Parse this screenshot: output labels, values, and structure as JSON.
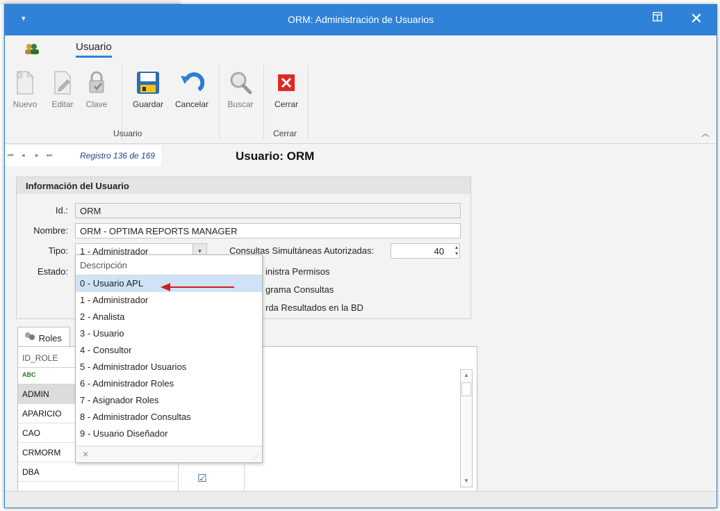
{
  "window": {
    "title": "ORM: Administración de Usuarios"
  },
  "ribbon": {
    "tab": "Usuario",
    "buttons": {
      "nuevo": "Nuevo",
      "editar": "Editar",
      "clave": "Clave",
      "guardar": "Guardar",
      "cancelar": "Cancelar",
      "buscar": "Buscar",
      "cerrar": "Cerrar"
    },
    "groups": {
      "usuario": "Usuario",
      "cerrar": "Cerrar"
    }
  },
  "nav": {
    "registro": "Registro 136 de 169"
  },
  "main_title": "Usuario: ORM",
  "info": {
    "header": "Información del Usuario",
    "id_label": "Id.:",
    "id_value": "ORM",
    "nombre_label": "Nombre:",
    "nombre_value": "ORM - OPTIMA REPORTS MANAGER",
    "tipo_label": "Tipo:",
    "tipo_value": "1 - Administrador",
    "consultas_label": "Consultas Simultáneas Autorizadas:",
    "consultas_value": "40",
    "estado_label": "Estado:",
    "administra_permisos": "inistra Permisos",
    "programa_consultas": "grama Consultas",
    "guarda_resultados": "rda Resultados en la BD"
  },
  "dropdown": {
    "header": "Descripción",
    "options": [
      "0 - Usuario APL",
      "1 - Administrador",
      "2 - Analista",
      "3 - Usuario",
      "4 - Consultor",
      "5 - Administrador Usuarios",
      "6 - Administrador Roles",
      "7 - Asignador Roles",
      "8 - Administrador Consultas",
      "9 - Usuario Diseñador"
    ],
    "highlighted_index": 0,
    "clear_glyph": "×"
  },
  "roles": {
    "tab": "Roles",
    "column_header": "ID_ROLE",
    "filter_glyph": "ABC",
    "rows": [
      "ADMIN",
      "APARICIO",
      "CAO",
      "CRMORM",
      "DBA"
    ]
  },
  "colors": {
    "titlebar": "#2f82d7",
    "highlight": "#cfe2f6",
    "arrow": "#d11f1f",
    "close_button": "#e02828"
  },
  "icons": [
    "users-icon",
    "new-document-icon",
    "edit-icon",
    "lock-icon",
    "save-icon",
    "undo-icon",
    "search-icon",
    "close-icon",
    "roles-icon"
  ]
}
